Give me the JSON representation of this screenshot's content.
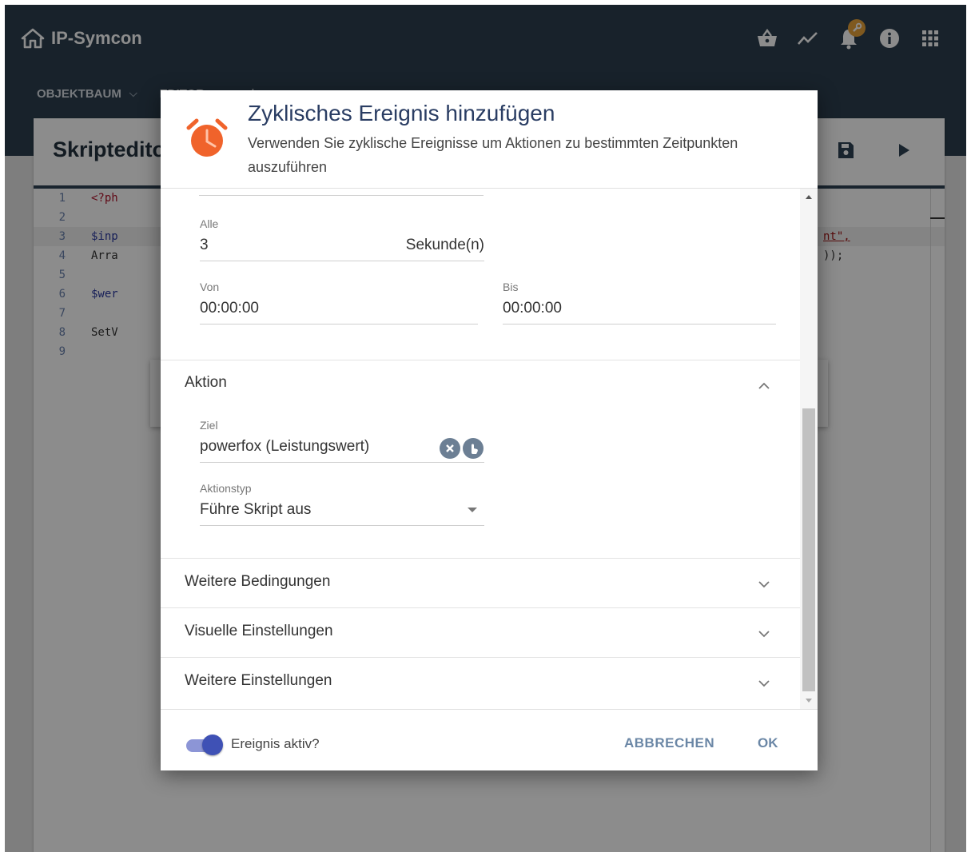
{
  "app": {
    "brand": "IP-Symcon",
    "tabs": [
      "OBJEKTBAUM",
      "EDITOR"
    ],
    "tab_add": "+",
    "header_icons": [
      "basket-icon",
      "trend-icon",
      "bell-icon",
      "info-icon",
      "apps-grid-icon"
    ]
  },
  "editor": {
    "title": "Skripteditor",
    "line_numbers": [
      "1",
      "2",
      "3",
      "4",
      "5",
      "6",
      "7",
      "8",
      "9"
    ],
    "lines": [
      "<?ph",
      "",
      "$inp",
      "Arra",
      "",
      "$wer",
      "",
      "SetV",
      ""
    ],
    "right_fragments": {
      "line3": "nt\",",
      "line4": "));"
    }
  },
  "dialog": {
    "title": "Zyklisches Ereignis hinzufügen",
    "subtitle": "Verwenden Sie zyklische Ereignisse um Aktionen zu bestimmten Zeitpunkten auszuführen",
    "fields": {
      "alle": {
        "label": "Alle",
        "value": "3",
        "unit": "Sekunde(n)"
      },
      "von": {
        "label": "Von",
        "value": "00:00:00"
      },
      "bis": {
        "label": "Bis",
        "value": "00:00:00"
      }
    },
    "aktion": {
      "title": "Aktion",
      "ziel": {
        "label": "Ziel",
        "value": "powerfox (Leistungswert)"
      },
      "aktionstyp": {
        "label": "Aktionstyp",
        "value": "Führe Skript aus"
      }
    },
    "sections": [
      "Weitere Bedingungen",
      "Visuelle Einstellungen",
      "Weitere Einstellungen"
    ],
    "toggle_label": "Ereignis aktiv?",
    "toggle_on": true,
    "cancel_label": "ABBRECHEN",
    "ok_label": "OK"
  },
  "colors": {
    "header_bg": "#2c3f4f",
    "accent": "#3f51b5",
    "clock": "#f0632b",
    "button_text": "#6b87a6"
  }
}
